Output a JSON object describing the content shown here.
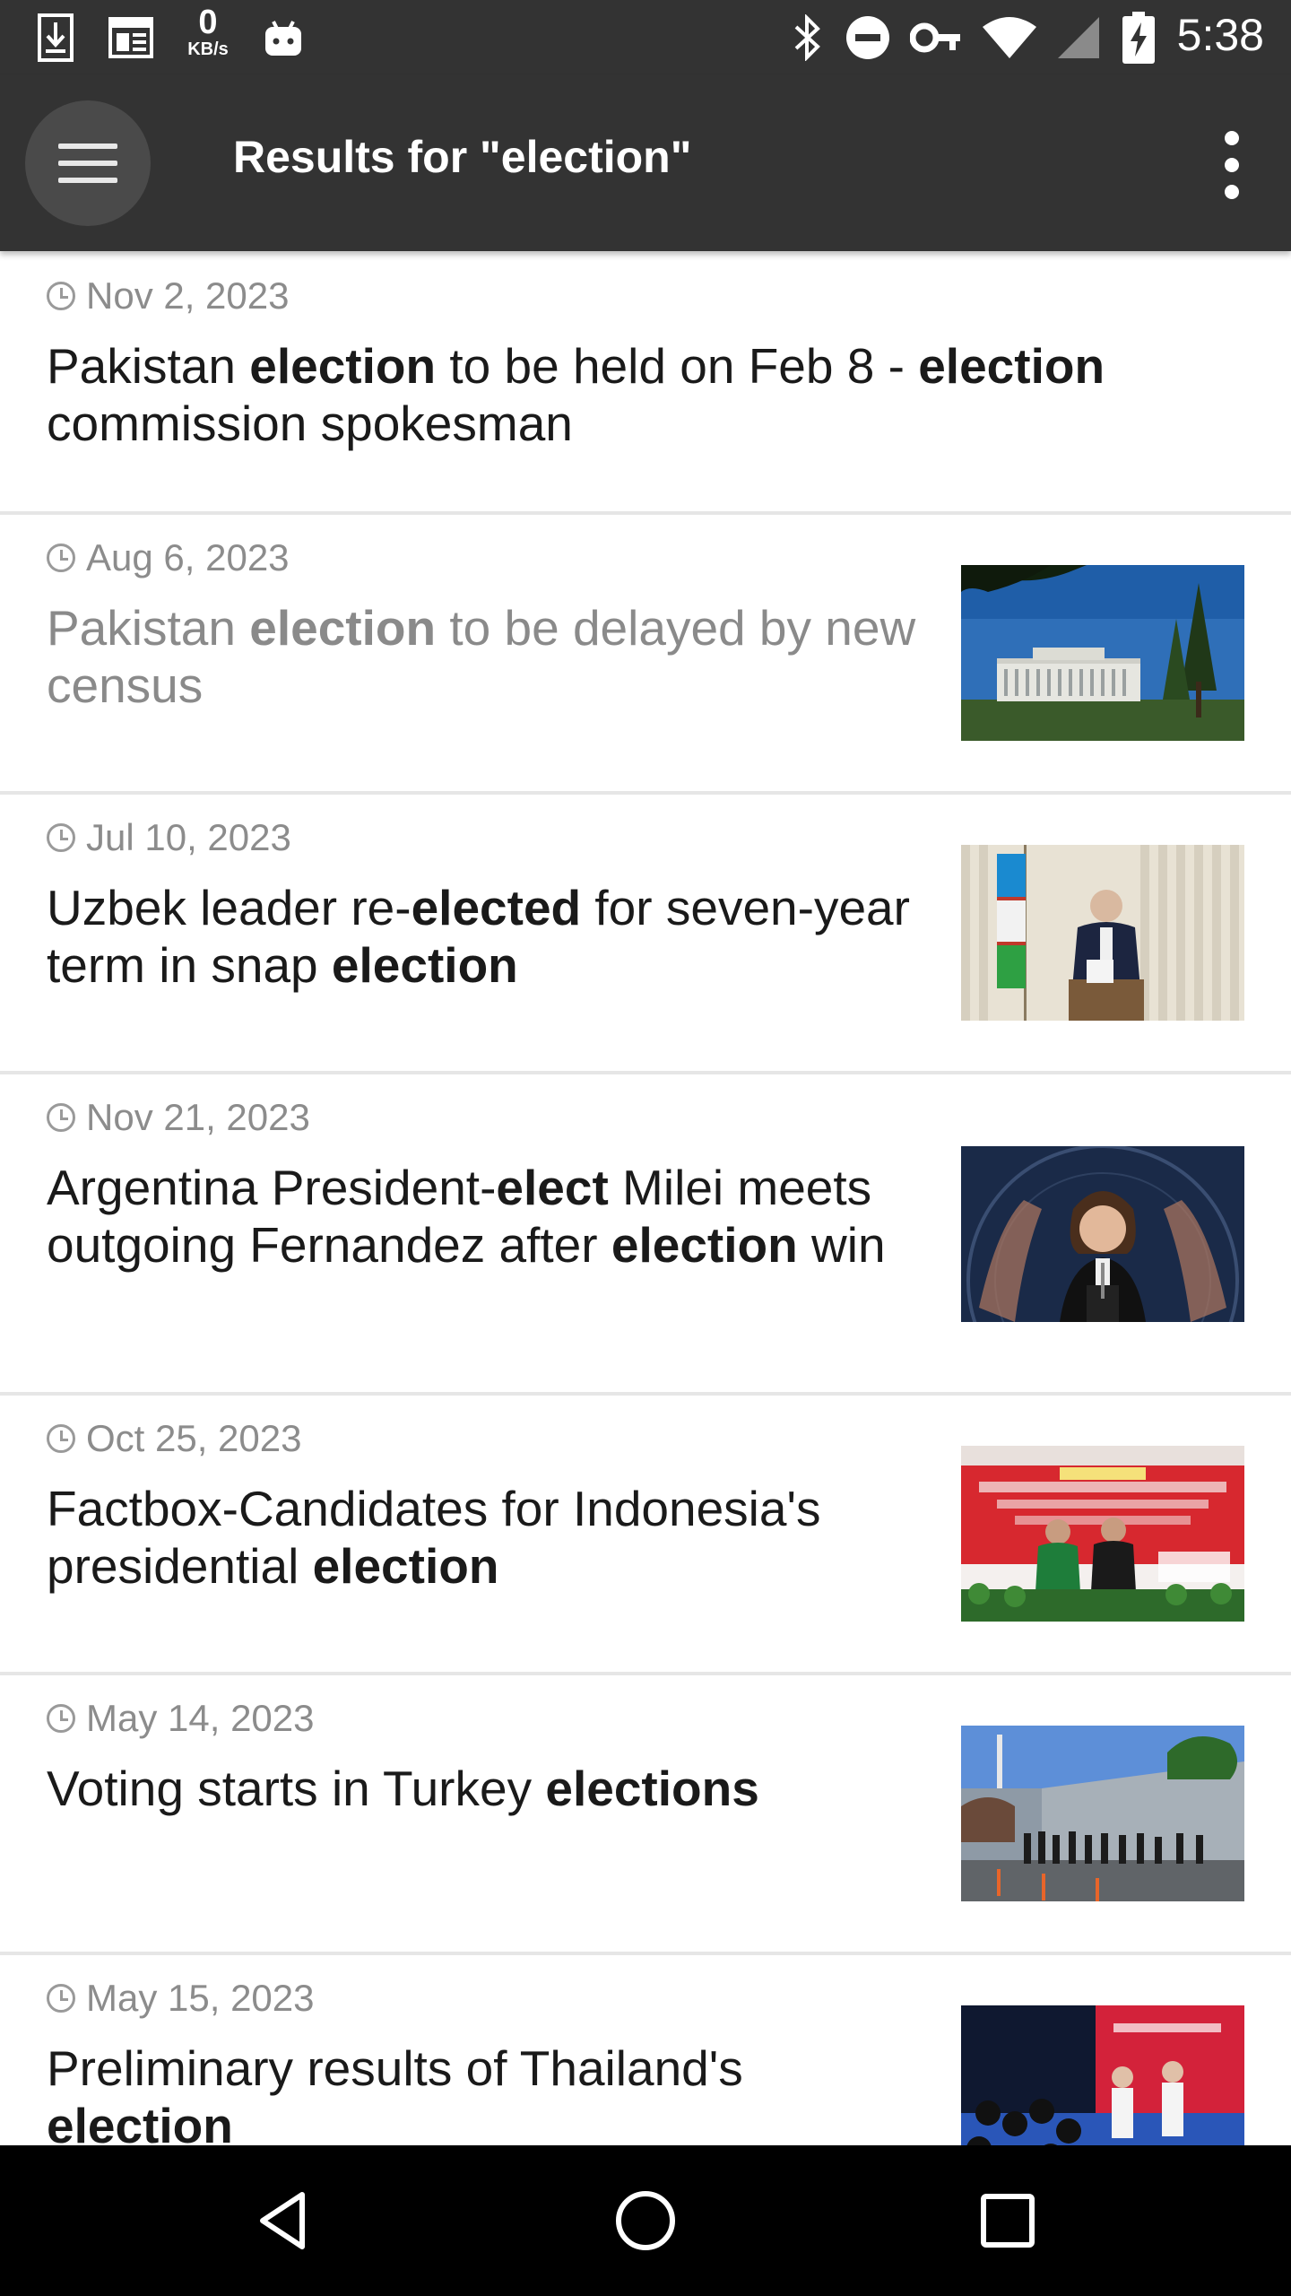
{
  "status_bar": {
    "time": "5:38",
    "speed_value": "0",
    "speed_unit": "KB/s",
    "icons": [
      "download-icon",
      "news-icon",
      "android-icon",
      "bluetooth-icon",
      "do-not-disturb-icon",
      "vpn-key-icon",
      "wifi-icon",
      "signal-icon",
      "battery-charging-icon"
    ]
  },
  "app_bar": {
    "title": "Results for \"election\"",
    "menu_icon": "hamburger-menu-icon",
    "overflow_icon": "more-vert-icon",
    "background": "#333333"
  },
  "articles": [
    {
      "date": "Nov 2, 2023",
      "read": false,
      "has_image": false,
      "headline": [
        {
          "text": "Pakistan ",
          "bold": false
        },
        {
          "text": "election",
          "bold": true
        },
        {
          "text": " to be held on Feb 8 - ",
          "bold": false
        },
        {
          "text": "election",
          "bold": true
        },
        {
          "text": " commission spokesman",
          "bold": false
        }
      ]
    },
    {
      "date": "Aug 6, 2023",
      "read": true,
      "has_image": true,
      "image": "parliament-building-photo",
      "headline": [
        {
          "text": "Pakistan ",
          "bold": false
        },
        {
          "text": "election",
          "bold": true
        },
        {
          "text": " to be delayed by new census",
          "bold": false
        }
      ]
    },
    {
      "date": "Jul 10, 2023",
      "read": false,
      "has_image": true,
      "image": "voter-ballot-box-photo",
      "headline": [
        {
          "text": "Uzbek leader re-",
          "bold": false
        },
        {
          "text": "elected",
          "bold": true
        },
        {
          "text": " for seven-year term in snap ",
          "bold": false
        },
        {
          "text": "election",
          "bold": true
        }
      ]
    },
    {
      "date": "Nov 21, 2023",
      "read": false,
      "has_image": true,
      "image": "president-elect-podium-photo",
      "headline": [
        {
          "text": "Argentina President-",
          "bold": false
        },
        {
          "text": "elect",
          "bold": true
        },
        {
          "text": " Milei meets outgoing Fernandez after ",
          "bold": false
        },
        {
          "text": "election",
          "bold": true
        },
        {
          "text": " win",
          "bold": false
        }
      ]
    },
    {
      "date": "Oct 25, 2023",
      "read": false,
      "has_image": true,
      "image": "candidates-stage-photo",
      "headline": [
        {
          "text": "Factbox-Candidates for Indonesia's presidential ",
          "bold": false
        },
        {
          "text": "election",
          "bold": true
        }
      ]
    },
    {
      "date": "May 14, 2023",
      "read": false,
      "has_image": true,
      "image": "voters-queue-photo",
      "headline": [
        {
          "text": "Voting starts in Turkey ",
          "bold": false
        },
        {
          "text": "elections",
          "bold": true
        }
      ]
    },
    {
      "date": "May 15, 2023",
      "read": false,
      "has_image": true,
      "image": "press-conference-photo",
      "headline": [
        {
          "text": "Preliminary results of Thailand's ",
          "bold": false
        },
        {
          "text": "election",
          "bold": true
        }
      ]
    }
  ],
  "nav_bar": {
    "buttons": [
      "back-icon",
      "home-icon",
      "recents-icon"
    ]
  }
}
